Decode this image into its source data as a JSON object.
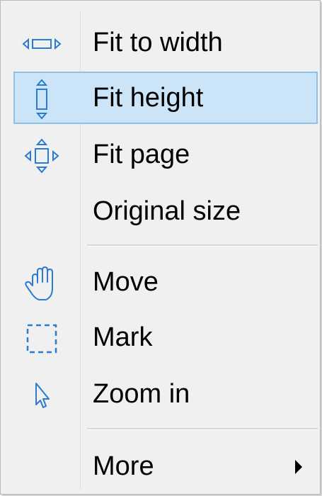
{
  "menu": {
    "accent_color": "#2b7bd0",
    "highlight_color": "#cce4f7",
    "items": [
      {
        "label": "Fit to width",
        "icon": "fit-width-icon",
        "highlighted": false
      },
      {
        "label": "Fit height",
        "icon": "fit-height-icon",
        "highlighted": true
      },
      {
        "label": "Fit page",
        "icon": "fit-page-icon",
        "highlighted": false
      },
      {
        "label": "Original size",
        "icon": null,
        "highlighted": false
      },
      {
        "label": "Move",
        "icon": "hand-icon",
        "highlighted": false
      },
      {
        "label": "Mark",
        "icon": "marquee-select-icon",
        "highlighted": false
      },
      {
        "label": "Zoom in",
        "icon": "pointer-arrow-icon",
        "highlighted": false
      },
      {
        "label": "More",
        "icon": null,
        "has_submenu": true,
        "submenu_icon": "submenu-arrow-icon",
        "highlighted": false
      }
    ]
  }
}
